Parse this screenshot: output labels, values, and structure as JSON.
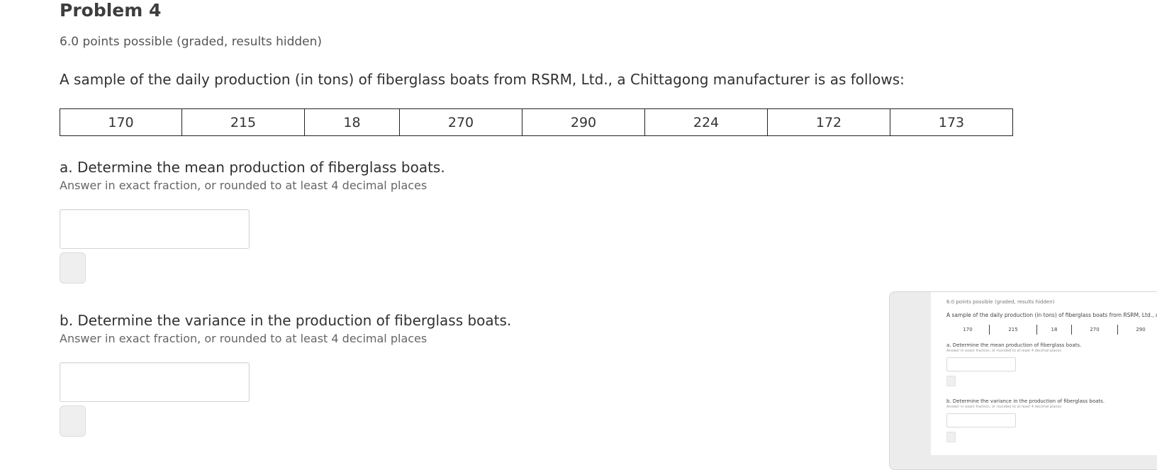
{
  "problem": {
    "title": "Problem 4",
    "points": "6.0 points possible (graded, results hidden)",
    "prompt": "A sample of the daily production (in tons) of fiberglass boats from RSRM, Ltd., a Chittagong manufacturer is as follows:"
  },
  "production_values": [
    "170",
    "215",
    "18",
    "270",
    "290",
    "224",
    "172",
    "173"
  ],
  "questions": {
    "a": {
      "text": "a. Determine the mean production of fiberglass boats.",
      "hint": "Answer in exact fraction, or rounded to at least 4 decimal places",
      "value": ""
    },
    "b": {
      "text": "b. Determine the variance in the production of fiberglass boats.",
      "hint": "Answer in exact fraction, or rounded to at least 4 decimal places",
      "value": ""
    }
  },
  "thumbnail": {
    "points": "6.0 points possible (graded, results hidden)",
    "prompt": "A sample of the daily production (in tons) of fiberglass boats from RSRM, Ltd., a Chittagong",
    "values": [
      "170",
      "215",
      "18",
      "270",
      "290"
    ],
    "question_a": "a. Determine the mean production of fiberglass boats.",
    "hint_a": "Answer in exact fraction, or rounded to at least 4 decimal places",
    "question_b": "b. Determine the variance in the production of fiberglass boats.",
    "hint_b": "Answer in exact fraction, or rounded to at least 4 decimal places"
  }
}
